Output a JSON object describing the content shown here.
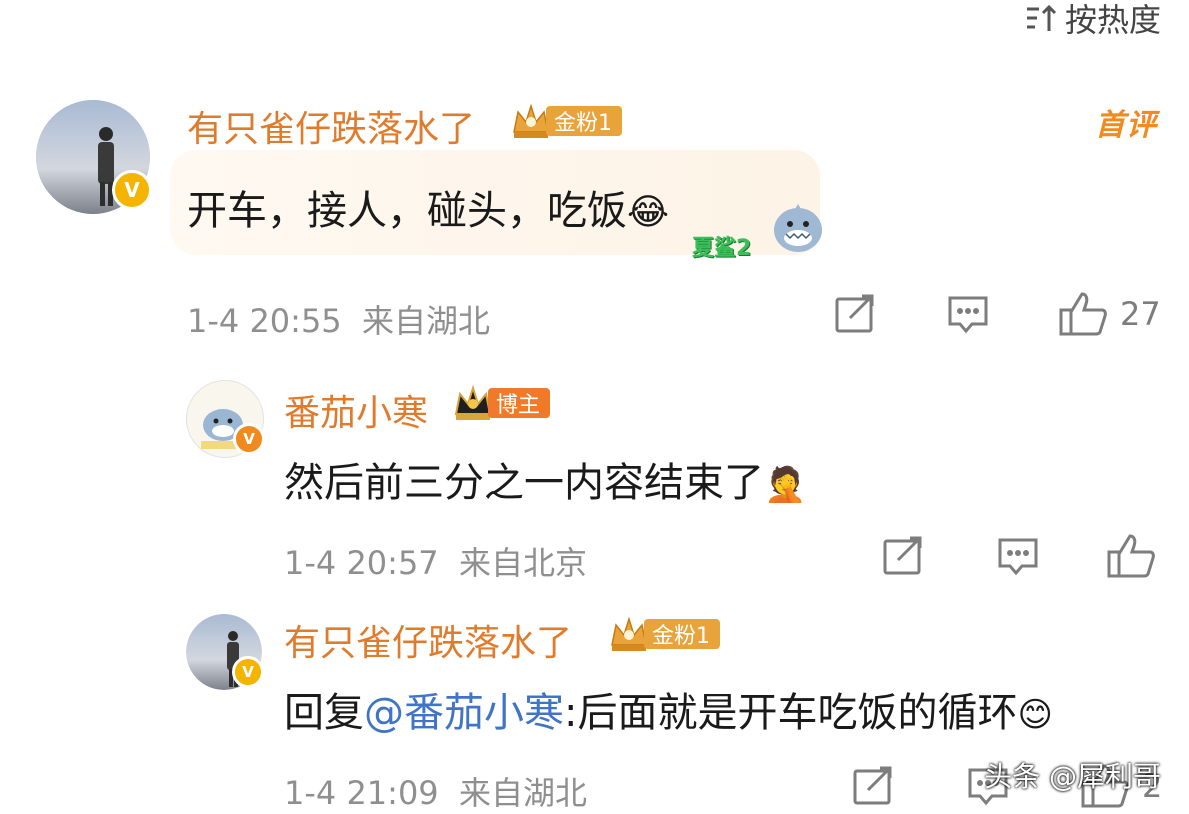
{
  "sort": {
    "label": "按热度",
    "icon": "sort-icon"
  },
  "first_tag": "首评",
  "comments": [
    {
      "user": "有只雀仔跌落水了",
      "badge": "金粉1",
      "text": "开车，接人，碰头，吃饭",
      "emoji": "😂",
      "time": "1-4 20:55",
      "location": "来自湖北",
      "likes": "27"
    },
    {
      "user": "番茄小寒",
      "badge": "博主",
      "text": "然后前三分之一内容结束了",
      "emoji": "🤦",
      "time": "1-4 20:57",
      "location": "来自北京",
      "likes": ""
    },
    {
      "user": "有只雀仔跌落水了",
      "badge": "金粉1",
      "reply_prefix": "回复",
      "reply_to": "@番茄小寒",
      "text": ":后面就是开车吃饭的循环",
      "emoji": "😊",
      "time": "1-4 21:09",
      "location": "来自湖北",
      "likes": "2"
    }
  ],
  "sticker_text": "夏鲨2",
  "watermark": "头条 @犀利哥",
  "colors": {
    "name": "#e07b2c",
    "badge_gold": "#e8a33a",
    "badge_host": "#f07a2a",
    "link": "#3f74c7"
  }
}
